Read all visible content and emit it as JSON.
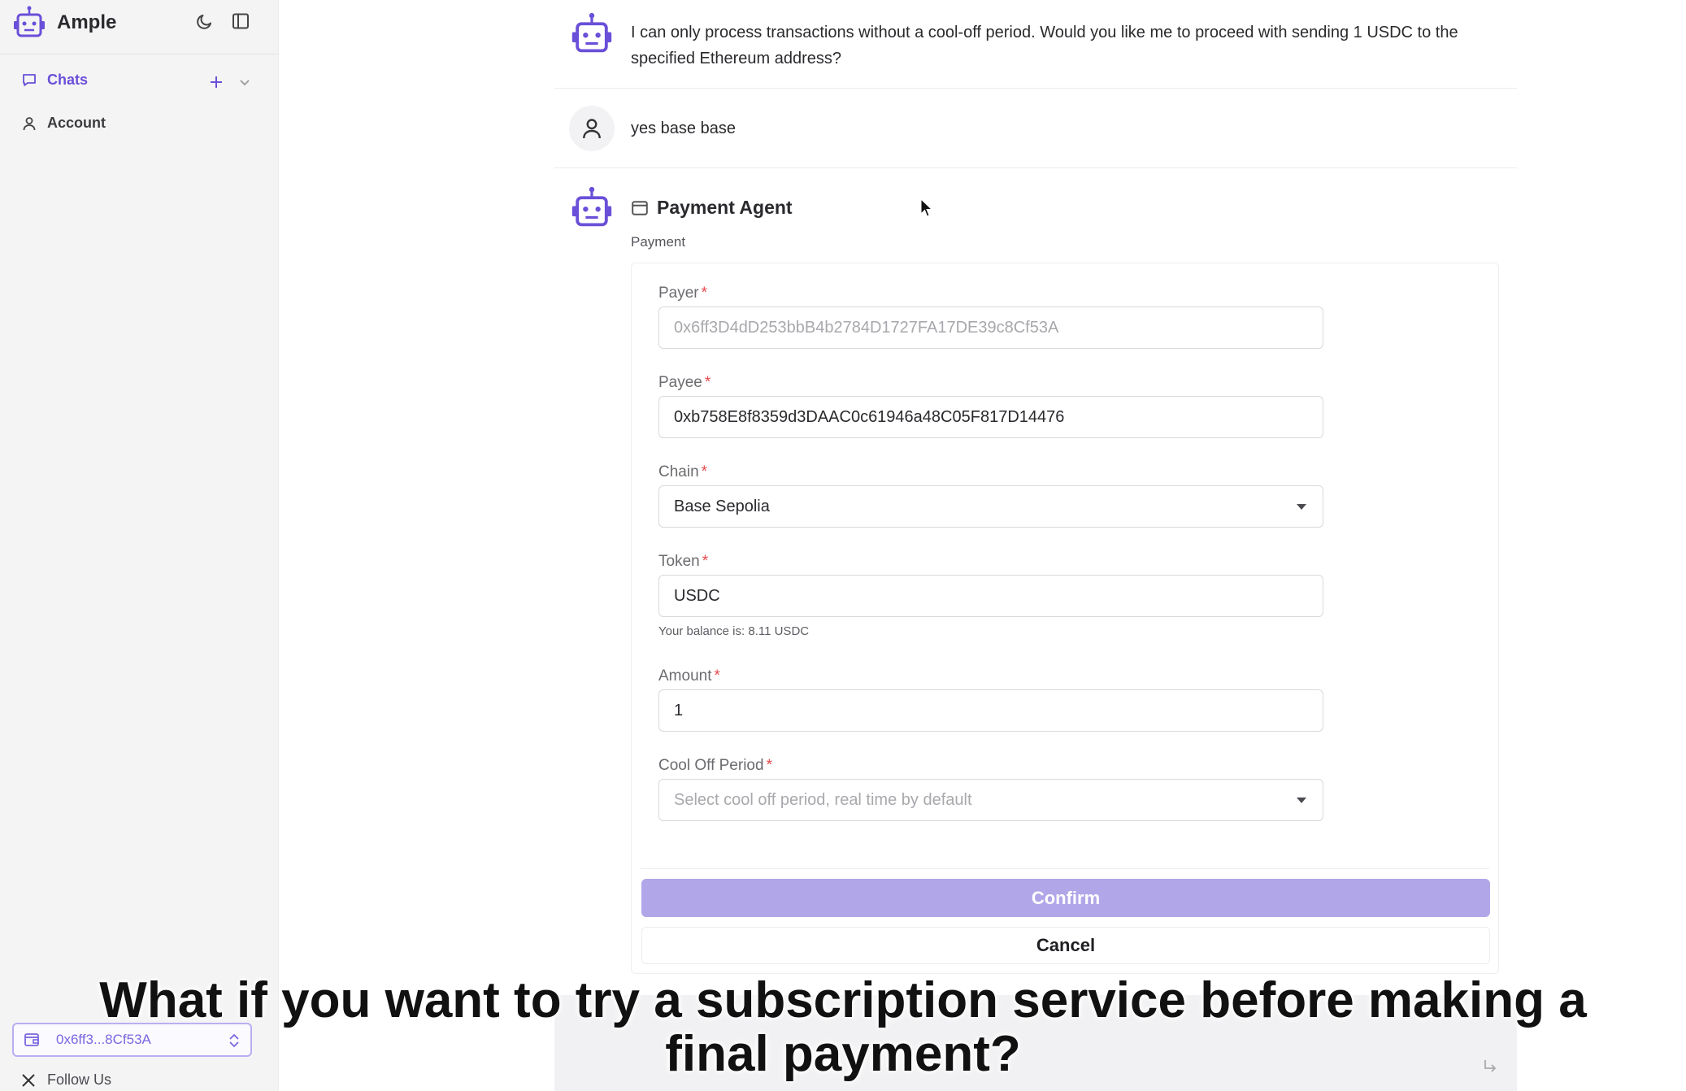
{
  "app": {
    "name": "Ample"
  },
  "sidebar": {
    "items": [
      {
        "label": "Chats"
      },
      {
        "label": "Account"
      }
    ],
    "wallet_address": "0x6ff3...8Cf53A",
    "follow_label": "Follow Us"
  },
  "chat": {
    "bot_message": "I can only process transactions without a cool-off period. Would you like me to proceed with sending 1 USDC to the specified Ethereum address?",
    "user_message": "yes base base"
  },
  "payment_agent": {
    "title": "Payment Agent",
    "subtitle": "Payment",
    "fields": {
      "payer": {
        "label": "Payer",
        "value": "0x6ff3D4dD253bbB4b2784D1727FA17DE39c8Cf53A"
      },
      "payee": {
        "label": "Payee",
        "value": "0xb758E8f8359d3DAAC0c61946a48C05F817D14476"
      },
      "chain": {
        "label": "Chain",
        "value": "Base Sepolia"
      },
      "token": {
        "label": "Token",
        "value": "USDC",
        "help": "Your balance is: 8.11 USDC"
      },
      "amount": {
        "label": "Amount",
        "value": "1"
      },
      "cool_off": {
        "label": "Cool Off Period",
        "placeholder": "Select cool off period, real time by default"
      }
    },
    "required_marker": "*",
    "confirm_label": "Confirm",
    "cancel_label": "Cancel"
  },
  "caption": "What if you want to try a subscription service before making a final payment?",
  "colors": {
    "accent": "#6a4fd8",
    "confirm_disabled": "#b1a6e8",
    "required": "#e5484d",
    "sidebar_bg": "#f4f4f5"
  },
  "icons": [
    "robot-icon",
    "moon-icon",
    "sidebar-toggle-icon",
    "chat-bubble-icon",
    "plus-icon",
    "chevron-down-icon",
    "user-icon",
    "wallet-icon",
    "swap-icon",
    "x-logo-icon",
    "enter-icon",
    "cursor-icon"
  ]
}
